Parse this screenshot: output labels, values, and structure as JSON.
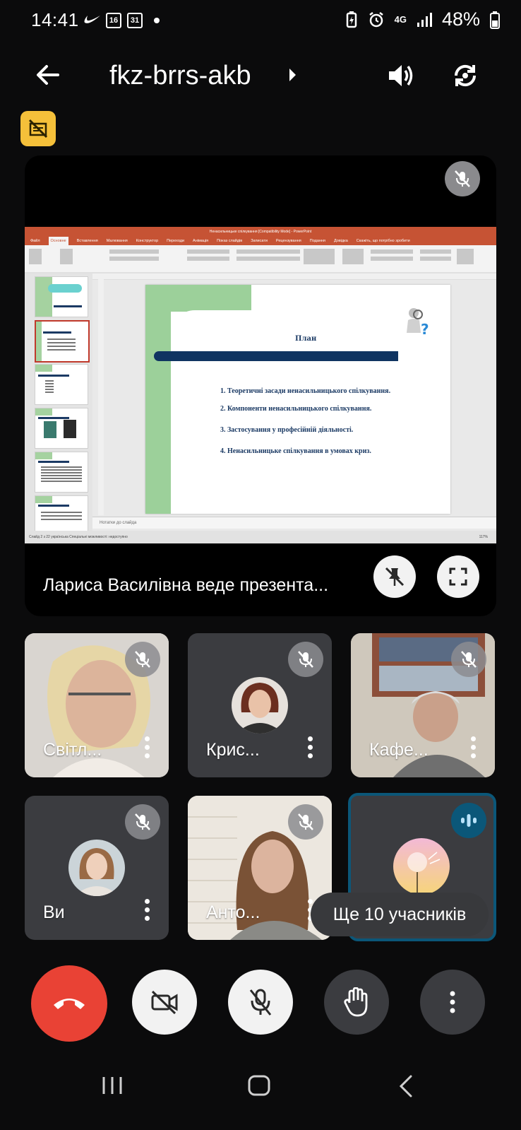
{
  "status_bar": {
    "time": "14:41",
    "cal_day_a": "16",
    "cal_day_b": "31",
    "network": "4G",
    "battery": "48%"
  },
  "header": {
    "meeting_code": "fkz-brrs-akb"
  },
  "presentation": {
    "presenter_label": "Лариса Василівна веде презента...",
    "ppt": {
      "window_title": "Ненасильницьке спілкування [Compatibility Mode] - PowerPoint",
      "tabs": [
        "Файл",
        "Основне",
        "Вставлення",
        "Малювання",
        "Конструктор",
        "Переходи",
        "Анімація",
        "Показ слайдів",
        "Записати",
        "Рецензування",
        "Подання",
        "Довідка"
      ],
      "search_hint": "Скажіть, що потрібно зробити",
      "slide_title": "План",
      "slide_items": [
        "1. Теоретичні засади ненасильницького спілкування.",
        "2. Компоненти ненасильницького спілкування.",
        "3. Застосування у професійній діяльності.",
        "4. Ненасильницьке спілкування в умовах криз."
      ],
      "notes_placeholder": "Нотатки до слайда",
      "status_text": "Слайд 2 з 22   українська   Спеціальні можливості: недоступно",
      "zoom": "117%"
    }
  },
  "participants": [
    {
      "name": "Світл..."
    },
    {
      "name": "Крис..."
    },
    {
      "name": "Кафе..."
    },
    {
      "name": "Ви"
    },
    {
      "name": "Анто..."
    }
  ],
  "more_participants": "Ще 10 учасників",
  "colors": {
    "end_call": "#e94235",
    "badge": "#f5c03a",
    "speaking_ring": "#0b5779"
  }
}
